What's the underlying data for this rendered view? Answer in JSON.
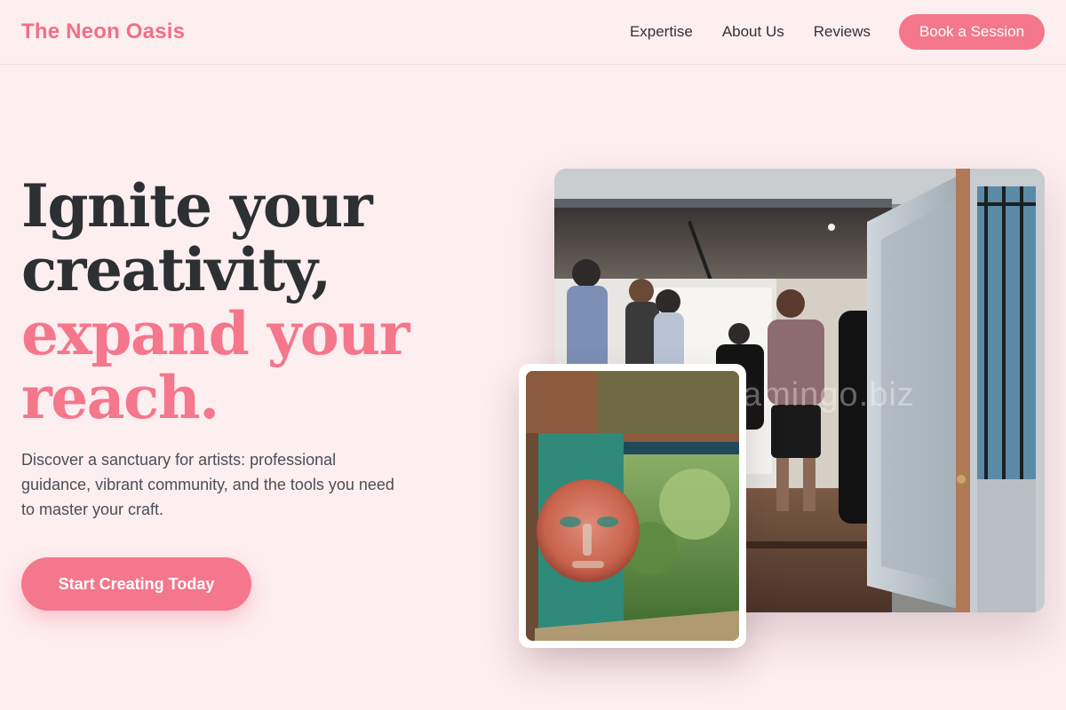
{
  "header": {
    "brand": "The Neon Oasis",
    "nav": [
      "Expertise",
      "About Us",
      "Reviews"
    ],
    "cta_label": "Book a Session"
  },
  "hero": {
    "title_line1": "Ignite your",
    "title_line2": "creativity,",
    "title_line3": "expand your",
    "title_line4": "reach.",
    "description": "Discover a sanctuary for artists: professional guidance, vibrant community, and the tools you need to master your craft.",
    "cta_label": "Start Creating Today"
  },
  "images": {
    "main_alt": "Gallery opening with visitors in an art studio",
    "secondary_alt": "Weathered mural of a face on a teal wall",
    "watermark": "amingo.biz"
  },
  "colors": {
    "accent": "#f4778b",
    "background": "#fdeef0",
    "heading": "#2c3033"
  }
}
